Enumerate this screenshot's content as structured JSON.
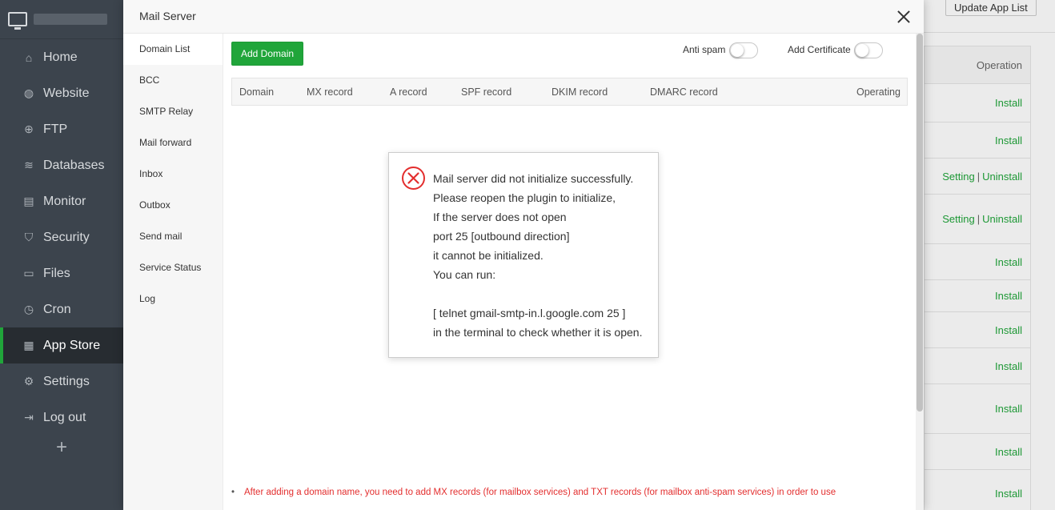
{
  "sidebar": {
    "items": [
      {
        "label": "Home",
        "icon": "home-icon"
      },
      {
        "label": "Website",
        "icon": "globe-icon"
      },
      {
        "label": "FTP",
        "icon": "ftp-icon"
      },
      {
        "label": "Databases",
        "icon": "database-icon"
      },
      {
        "label": "Monitor",
        "icon": "monitor-icon"
      },
      {
        "label": "Security",
        "icon": "shield-icon"
      },
      {
        "label": "Files",
        "icon": "folder-icon"
      },
      {
        "label": "Cron",
        "icon": "cron-icon"
      },
      {
        "label": "App Store",
        "icon": "grid-icon"
      },
      {
        "label": "Settings",
        "icon": "gear-icon"
      },
      {
        "label": "Log out",
        "icon": "logout-icon"
      }
    ],
    "add_symbol": "+"
  },
  "background": {
    "update_button": "Update App List",
    "operation_header": "Operation",
    "operations": [
      {
        "actions": [
          "Install"
        ]
      },
      {
        "actions": [
          "Install"
        ]
      },
      {
        "actions": [
          "Setting",
          "Uninstall"
        ]
      },
      {
        "actions": [
          "Setting",
          "Uninstall"
        ]
      },
      {
        "actions": [
          "Install"
        ]
      },
      {
        "actions": [
          "Install"
        ]
      },
      {
        "actions": [
          "Install"
        ]
      },
      {
        "actions": [
          "Install"
        ]
      },
      {
        "actions": [
          "Install"
        ]
      },
      {
        "actions": [
          "Install"
        ]
      },
      {
        "actions": [
          "Install"
        ]
      }
    ],
    "separator": "|"
  },
  "modal": {
    "title": "Mail Server",
    "menu": [
      "Domain List",
      "BCC",
      "SMTP Relay",
      "Mail forward",
      "Inbox",
      "Outbox",
      "Send mail",
      "Service Status",
      "Log"
    ],
    "add_domain_button": "Add Domain",
    "anti_spam_label": "Anti spam",
    "anti_spam_enabled": false,
    "add_certificate_label": "Add Certificate",
    "add_certificate_enabled": false,
    "table_headers": [
      "Domain",
      "MX record",
      "A record",
      "SPF record",
      "DKIM record",
      "DMARC record",
      "Operating"
    ],
    "tip": "After adding a domain name, you need to add MX records (for mailbox services) and TXT records (for mailbox anti-spam services) in order to use"
  },
  "alert": {
    "icon": "error-circle-icon",
    "lines": [
      "Mail server did not initialize successfully.",
      "Please reopen the plugin to initialize,",
      "If the server does not open",
      "port 25 [outbound direction]",
      "it cannot be initialized.",
      "You can run:",
      "",
      "[ telnet gmail-smtp-in.l.google.com 25 ]",
      "in the terminal to check whether it is open."
    ]
  },
  "colors": {
    "accent": "#20a53a",
    "sidebar_bg": "#3c444d",
    "error": "#e32e2e"
  }
}
